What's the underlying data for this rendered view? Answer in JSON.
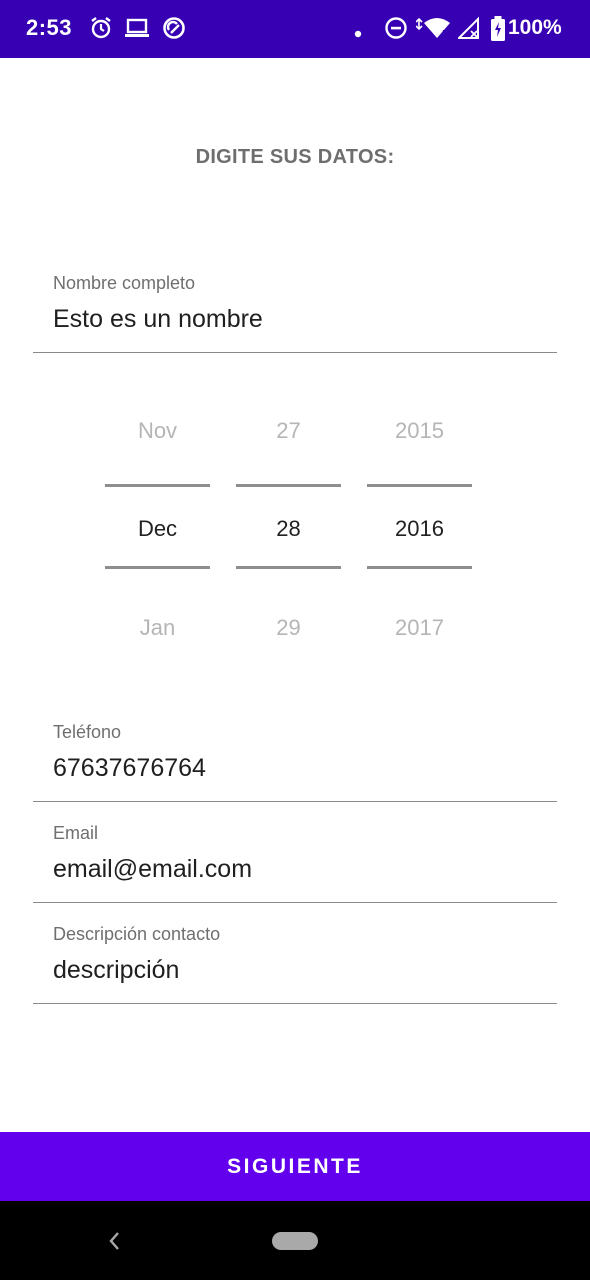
{
  "status_bar": {
    "time": "2:53",
    "battery_percent": "100%",
    "left_icons": [
      "alarm-icon",
      "laptop-icon",
      "sync-icon"
    ],
    "right_icons": [
      "dot-icon",
      "do-not-disturb-icon",
      "wifi-icon",
      "signal-icon",
      "battery-icon"
    ]
  },
  "form": {
    "title": "DIGITE SUS DATOS:",
    "name": {
      "label": "Nombre completo",
      "value": "Esto es un nombre"
    },
    "date_picker": {
      "month": {
        "prev": "Nov",
        "selected": "Dec",
        "next": "Jan"
      },
      "day": {
        "prev": "27",
        "selected": "28",
        "next": "29"
      },
      "year": {
        "prev": "2015",
        "selected": "2016",
        "next": "2017"
      }
    },
    "phone": {
      "label": "Teléfono",
      "value": "67637676764"
    },
    "email": {
      "label": "Email",
      "value": "email@email.com"
    },
    "description": {
      "label": "Descripción contacto",
      "value": "descripción"
    }
  },
  "next_button": {
    "label": "SIGUIENTE"
  },
  "colors": {
    "status_bar": "#3700b3",
    "primary": "#6200ee",
    "nav_bar": "#000000"
  },
  "nav_bar": {
    "back_icon": "back-chevron-icon",
    "home_icon": "home-pill-icon"
  }
}
